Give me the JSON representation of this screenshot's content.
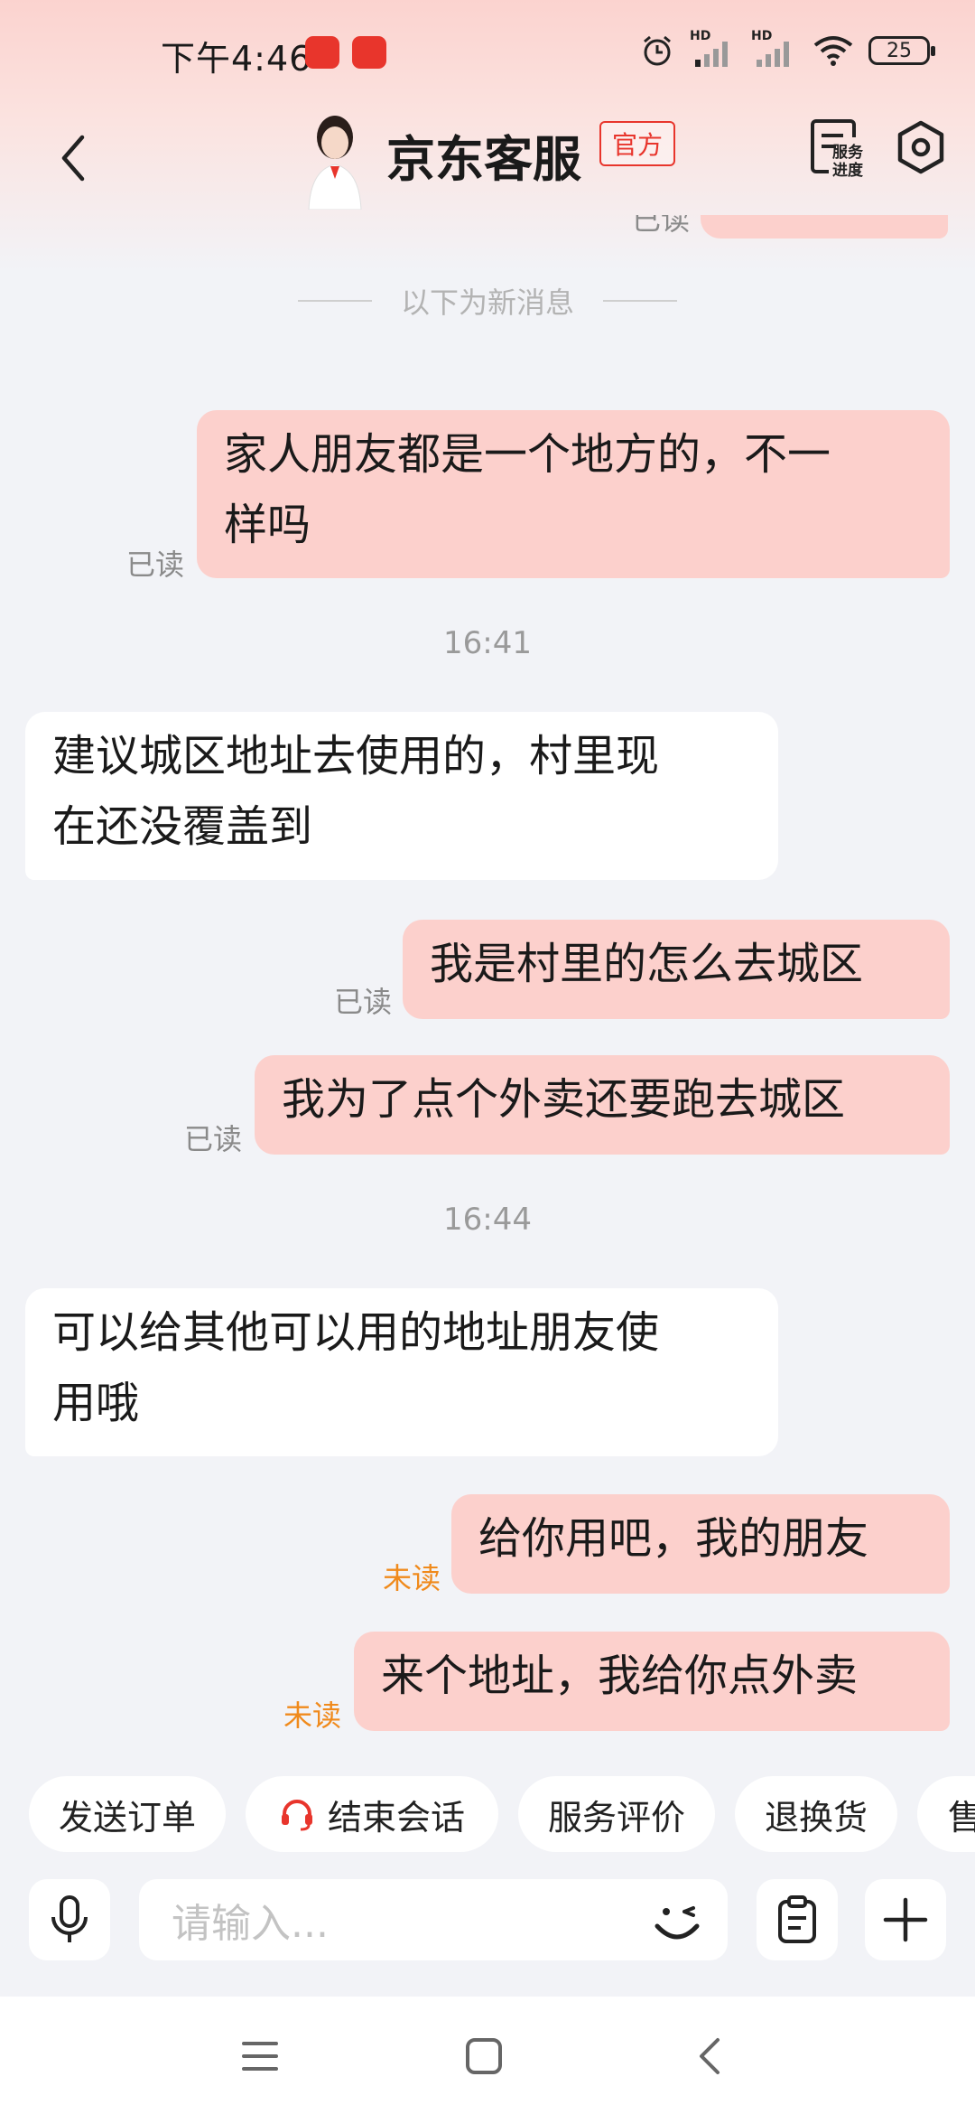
{
  "status_bar": {
    "time": "下午4:46",
    "battery": "25",
    "network_labels": [
      "HD",
      "HD"
    ]
  },
  "header": {
    "agent_name": "京东客服",
    "official_tag": "官方",
    "service_progress_label": "服务进度",
    "service_progress_line1": "服务",
    "service_progress_line2": "进度"
  },
  "chat": {
    "partial_read_label": "已读",
    "new_messages_divider": "以下为新消息",
    "messages": [
      {
        "from": "me",
        "text_line1": "家人朋友都是一个地方的，不一",
        "text_line2": "样吗",
        "status": "已读"
      },
      {
        "time": "16:41"
      },
      {
        "from": "agent",
        "text_line1": "建议城区地址去使用的，村里现",
        "text_line2": "在还没覆盖到"
      },
      {
        "from": "me",
        "text": "我是村里的怎么去城区",
        "status": "已读"
      },
      {
        "from": "me",
        "text": "我为了点个外卖还要跑去城区",
        "status": "已读"
      },
      {
        "time": "16:44"
      },
      {
        "from": "agent",
        "text_line1": "可以给其他可以用的地址朋友使",
        "text_line2": "用哦"
      },
      {
        "from": "me",
        "text": "给你用吧，我的朋友",
        "status": "未读"
      },
      {
        "from": "me",
        "text": "来个地址，我给你点外卖",
        "status": "未读"
      }
    ]
  },
  "quick_actions": [
    "发送订单",
    "结束会话",
    "服务评价",
    "退换货",
    "售"
  ],
  "input": {
    "placeholder": "请输入..."
  },
  "colors": {
    "my_bubble": "#fcd0cc",
    "accent_red": "#e8352c",
    "unread_orange": "#f08a1c",
    "background": "#f2f3f7"
  },
  "icons": [
    "back-icon",
    "service-progress-icon",
    "settings-icon",
    "microphone-icon",
    "emoji-icon",
    "clipboard-icon",
    "plus-icon",
    "headset-icon",
    "menu-icon",
    "home-icon",
    "system-back-icon"
  ]
}
